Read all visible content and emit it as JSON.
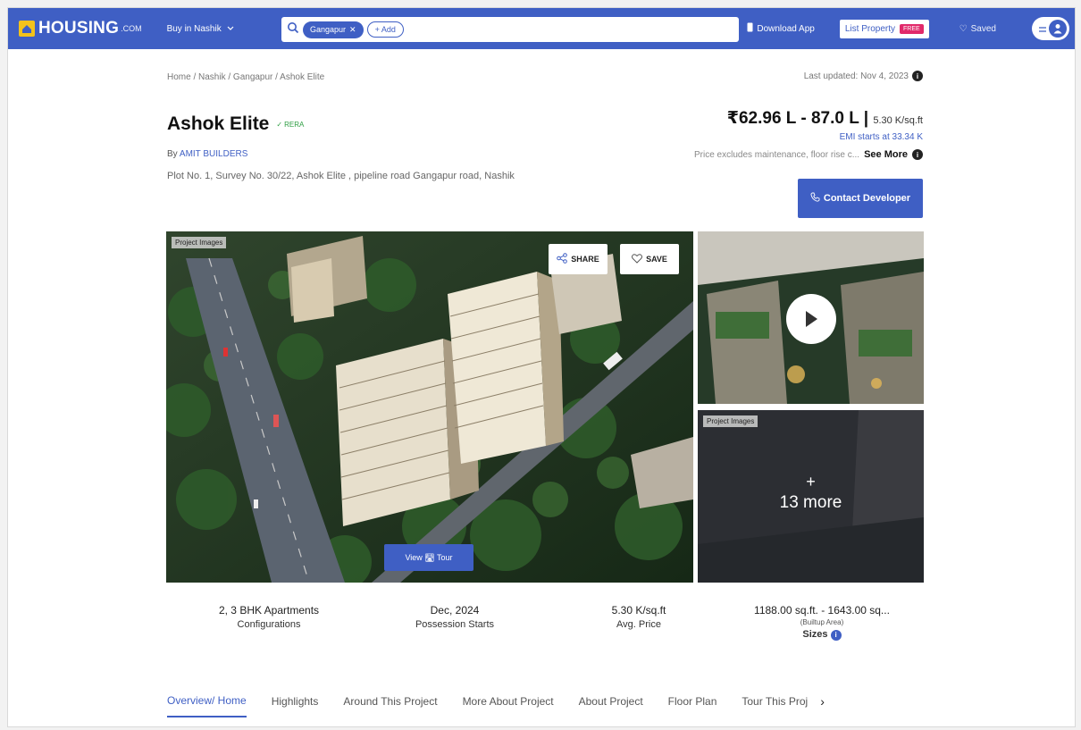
{
  "nav": {
    "logo": "HOUSING",
    "logo_suffix": ".COM",
    "buy_in": "Buy in Nashik",
    "search_chip": "Gangapur",
    "search_add": "+ Add",
    "download": "Download App",
    "list_property": "List Property",
    "free_badge": "FREE",
    "saved": "Saved"
  },
  "breadcrumb": "Home / Nashik / Gangapur / Ashok Elite",
  "last_updated": "Last updated: Nov 4, 2023",
  "project": {
    "name": "Ashok Elite",
    "rera": "RERA",
    "by_prefix": "By",
    "builder": "AMIT BUILDERS",
    "address": "Plot No. 1, Survey No. 30/22, Ashok Elite , pipeline road Gangapur road, Nashik"
  },
  "price": {
    "range": "₹62.96 L - 87.0 L |",
    "per_sqft": "5.30 K/sq.ft",
    "emi": "EMI starts at  33.34 K",
    "excludes": "Price excludes maintenance, floor rise c...",
    "see_more": "See More"
  },
  "buttons": {
    "contact": "Contact Developer",
    "share": "SHARE",
    "save": "SAVE",
    "view_tour": "View 🛣 Tour"
  },
  "media": {
    "main_tag": "Project Images",
    "side_tag": "Project Images",
    "more_plus": "+",
    "more_count": "13 more"
  },
  "stats": [
    {
      "value": "2, 3 BHK Apartments",
      "label": "Configurations"
    },
    {
      "value": "Dec, 2024",
      "label": "Possession Starts"
    },
    {
      "value": "5.30 K/sq.ft",
      "label": "Avg. Price"
    },
    {
      "value": "1188.00 sq.ft. - 1643.00 sq...",
      "sub": "(Builtup Area)",
      "label": "Sizes"
    }
  ],
  "tabs": [
    "Overview/ Home",
    "Highlights",
    "Around This Project",
    "More About Project",
    "About Project",
    "Floor Plan",
    "Tour This Proj"
  ],
  "colors": {
    "brand": "#3f5fc4",
    "accent": "#f3c21b",
    "free": "#e1296a"
  }
}
